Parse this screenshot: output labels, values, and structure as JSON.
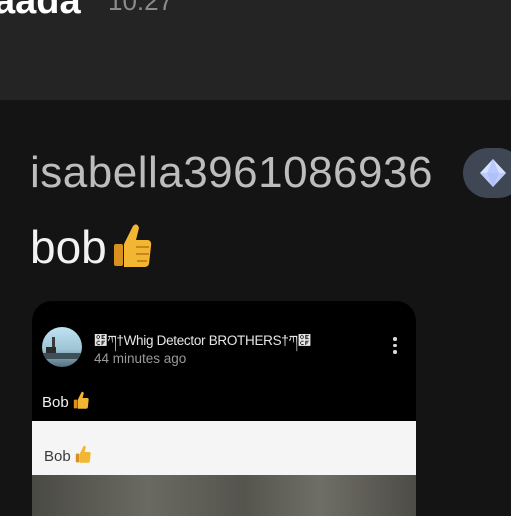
{
  "header": {
    "name": "aada",
    "time": "10:27"
  },
  "message": {
    "username": "isabella3961086936",
    "badge_icon": "diamond-icon",
    "text": "bob",
    "emoji": "thumbs-up-icon"
  },
  "shared_post": {
    "author": "໏ཀ†Whig Detector BROTHERS†ཀ໏",
    "time": "44 minutes ago",
    "text": "Bob",
    "preview_text": "Bob",
    "menu_icon": "kebab-menu-icon"
  },
  "colors": {
    "badge_bg": "#3f4654",
    "emoji_yellow": "#f2b632"
  }
}
